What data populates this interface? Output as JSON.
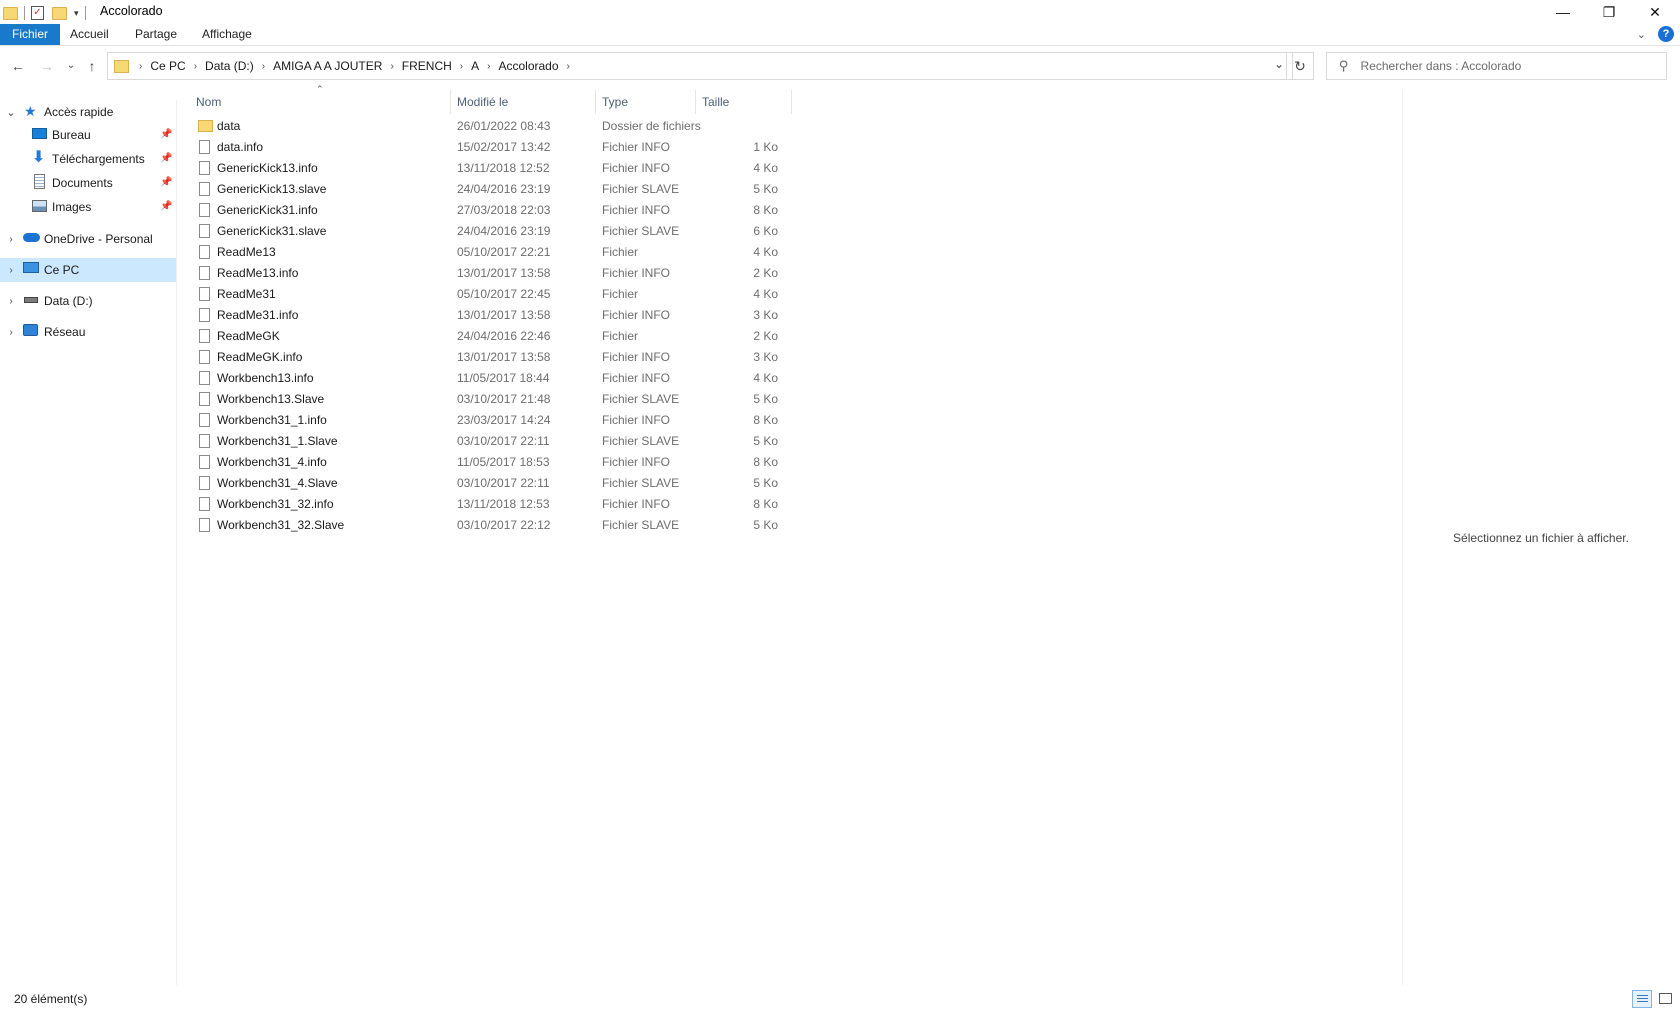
{
  "window": {
    "title": "Accolorado",
    "minimize_glyph": "—",
    "restore_glyph": "❐",
    "close_glyph": "✕"
  },
  "ribbon": {
    "tabs": [
      "Fichier",
      "Accueil",
      "Partage",
      "Affichage"
    ],
    "help_glyph": "?"
  },
  "address": {
    "breadcrumbs": [
      "Ce PC",
      "Data (D:)",
      "AMIGA A A JOUTER",
      "FRENCH",
      "A",
      "Accolorado"
    ],
    "search_placeholder": "Rechercher dans : Accolorado"
  },
  "nav_pane": {
    "quick_access": "Accès rapide",
    "pinned": [
      "Bureau",
      "Téléchargements",
      "Documents",
      "Images"
    ],
    "onedrive": "OneDrive - Personal",
    "this_pc": "Ce PC",
    "drive": "Data (D:)",
    "network": "Réseau"
  },
  "columns": {
    "name": "Nom",
    "modified": "Modifié le",
    "type": "Type",
    "size": "Taille"
  },
  "files": [
    {
      "name": "data",
      "modified": "26/01/2022 08:43",
      "type": "Dossier de fichiers",
      "size": "",
      "folder": true
    },
    {
      "name": "data.info",
      "modified": "15/02/2017 13:42",
      "type": "Fichier INFO",
      "size": "1 Ko"
    },
    {
      "name": "GenericKick13.info",
      "modified": "13/11/2018 12:52",
      "type": "Fichier INFO",
      "size": "4 Ko"
    },
    {
      "name": "GenericKick13.slave",
      "modified": "24/04/2016 23:19",
      "type": "Fichier SLAVE",
      "size": "5 Ko"
    },
    {
      "name": "GenericKick31.info",
      "modified": "27/03/2018 22:03",
      "type": "Fichier INFO",
      "size": "8 Ko"
    },
    {
      "name": "GenericKick31.slave",
      "modified": "24/04/2016 23:19",
      "type": "Fichier SLAVE",
      "size": "6 Ko"
    },
    {
      "name": "ReadMe13",
      "modified": "05/10/2017 22:21",
      "type": "Fichier",
      "size": "4 Ko"
    },
    {
      "name": "ReadMe13.info",
      "modified": "13/01/2017 13:58",
      "type": "Fichier INFO",
      "size": "2 Ko"
    },
    {
      "name": "ReadMe31",
      "modified": "05/10/2017 22:45",
      "type": "Fichier",
      "size": "4 Ko"
    },
    {
      "name": "ReadMe31.info",
      "modified": "13/01/2017 13:58",
      "type": "Fichier INFO",
      "size": "3 Ko"
    },
    {
      "name": "ReadMeGK",
      "modified": "24/04/2016 22:46",
      "type": "Fichier",
      "size": "2 Ko"
    },
    {
      "name": "ReadMeGK.info",
      "modified": "13/01/2017 13:58",
      "type": "Fichier INFO",
      "size": "3 Ko"
    },
    {
      "name": "Workbench13.info",
      "modified": "11/05/2017 18:44",
      "type": "Fichier INFO",
      "size": "4 Ko"
    },
    {
      "name": "Workbench13.Slave",
      "modified": "03/10/2017 21:48",
      "type": "Fichier SLAVE",
      "size": "5 Ko"
    },
    {
      "name": "Workbench31_1.info",
      "modified": "23/03/2017 14:24",
      "type": "Fichier INFO",
      "size": "8 Ko"
    },
    {
      "name": "Workbench31_1.Slave",
      "modified": "03/10/2017 22:11",
      "type": "Fichier SLAVE",
      "size": "5 Ko"
    },
    {
      "name": "Workbench31_4.info",
      "modified": "11/05/2017 18:53",
      "type": "Fichier INFO",
      "size": "8 Ko"
    },
    {
      "name": "Workbench31_4.Slave",
      "modified": "03/10/2017 22:11",
      "type": "Fichier SLAVE",
      "size": "5 Ko"
    },
    {
      "name": "Workbench31_32.info",
      "modified": "13/11/2018 12:53",
      "type": "Fichier INFO",
      "size": "8 Ko"
    },
    {
      "name": "Workbench31_32.Slave",
      "modified": "03/10/2017 22:12",
      "type": "Fichier SLAVE",
      "size": "5 Ko"
    }
  ],
  "preview": {
    "message": "Sélectionnez un fichier à afficher."
  },
  "status": {
    "count": "20 élément(s)"
  },
  "colors": {
    "accent": "#1979ca",
    "selection": "#cce8ff",
    "folder": "#f8d775",
    "header_text": "#4c607a"
  },
  "icons": {
    "back": "arrow-left-icon",
    "forward": "arrow-right-icon",
    "recent": "chevron-down-icon",
    "up": "arrow-up-icon",
    "refresh": "refresh-icon",
    "search": "search-icon",
    "pin": "pin-icon"
  }
}
